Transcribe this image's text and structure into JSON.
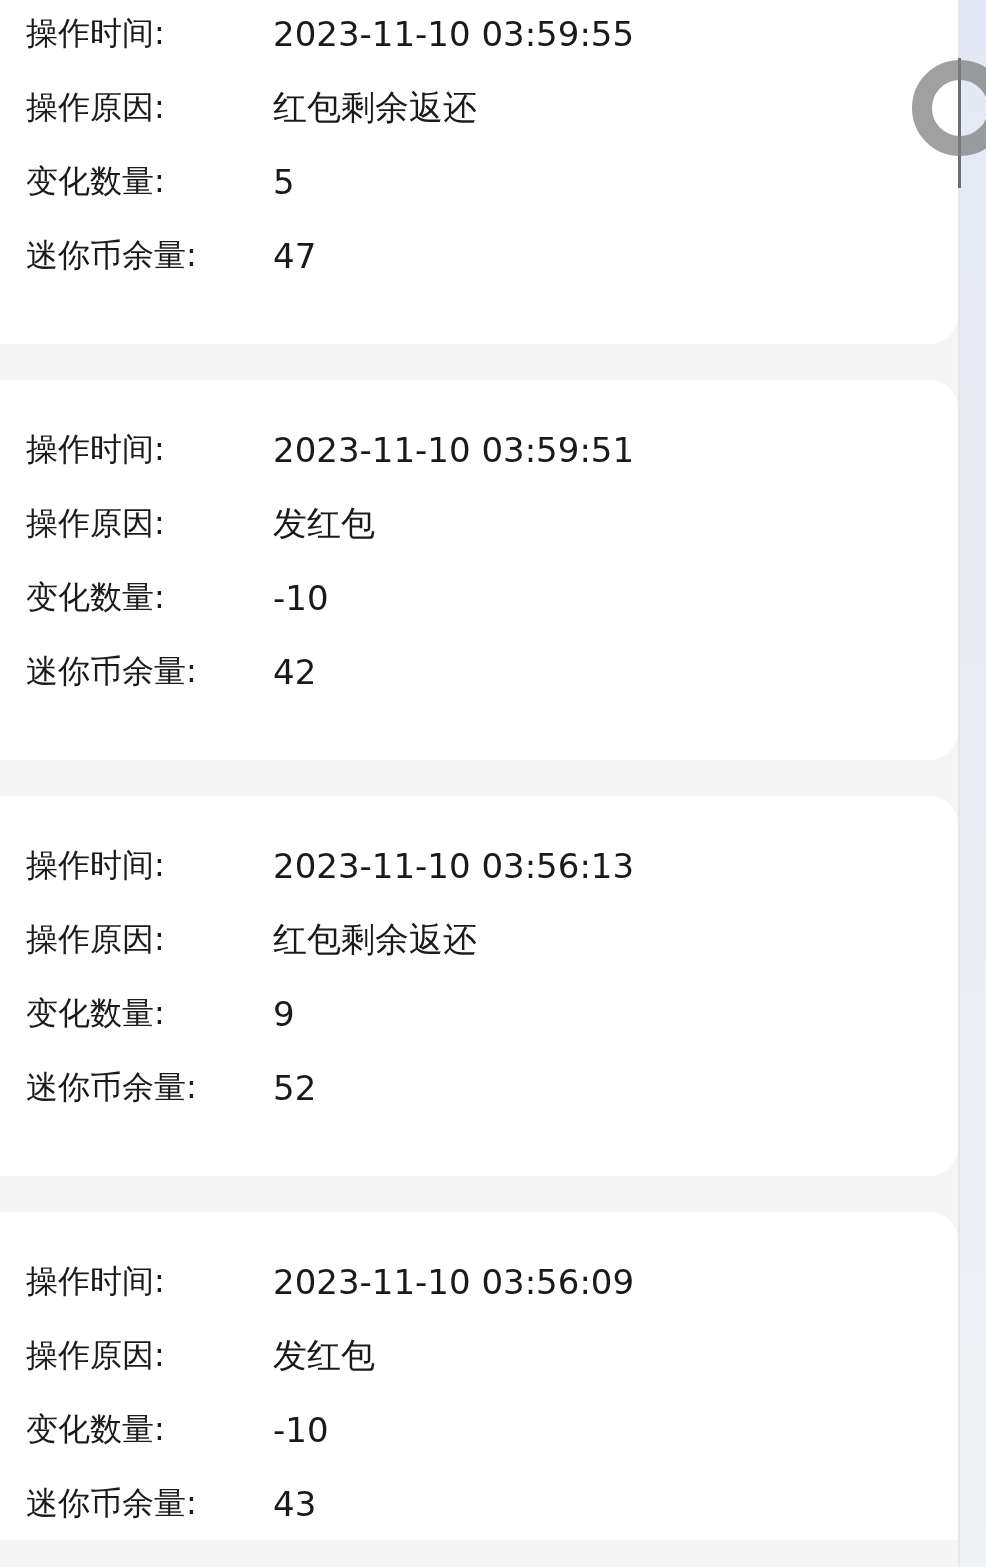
{
  "records": [
    {
      "fields": [
        {
          "label": "操作时间:",
          "value": "2023-11-10 03:59:55"
        },
        {
          "label": "操作原因:",
          "value": "红包剩余返还"
        },
        {
          "label": "变化数量:",
          "value": "5"
        },
        {
          "label": "迷你币余量:",
          "value": "47"
        }
      ]
    },
    {
      "fields": [
        {
          "label": "操作时间:",
          "value": "2023-11-10 03:59:51"
        },
        {
          "label": "操作原因:",
          "value": "发红包"
        },
        {
          "label": "变化数量:",
          "value": "-10"
        },
        {
          "label": "迷你币余量:",
          "value": "42"
        }
      ]
    },
    {
      "fields": [
        {
          "label": "操作时间:",
          "value": "2023-11-10 03:56:13"
        },
        {
          "label": "操作原因:",
          "value": "红包剩余返还"
        },
        {
          "label": "变化数量:",
          "value": "9"
        },
        {
          "label": "迷你币余量:",
          "value": "52"
        }
      ]
    },
    {
      "fields": [
        {
          "label": "操作时间:",
          "value": "2023-11-10 03:56:09"
        },
        {
          "label": "操作原因:",
          "value": "发红包"
        },
        {
          "label": "变化数量:",
          "value": "-10"
        },
        {
          "label": "迷你币余量:",
          "value": "43"
        }
      ]
    }
  ]
}
